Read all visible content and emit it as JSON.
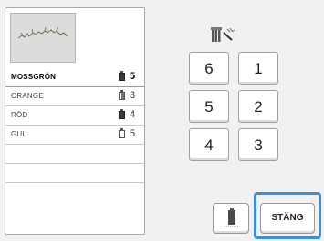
{
  "thread_list": [
    {
      "name": "MOSSGRÖN",
      "count": "5",
      "spool": "dark",
      "selected": true
    },
    {
      "name": "ORANGE",
      "count": "3",
      "spool": "mid",
      "selected": false
    },
    {
      "name": "RÖD",
      "count": "4",
      "spool": "dark",
      "selected": false
    },
    {
      "name": "GUL",
      "count": "5",
      "spool": "light",
      "selected": false
    }
  ],
  "order_buttons": {
    "b6": "6",
    "b1": "1",
    "b5": "5",
    "b2": "2",
    "b4": "4",
    "b3": "3"
  },
  "close_label": "STÄNG",
  "colors": {
    "highlight": "#3a8fd6",
    "panel_bg": "#f1f1f1"
  },
  "icons": {
    "needle": "needle-bar-icon",
    "thread_spool": "thread-spool-icon"
  }
}
